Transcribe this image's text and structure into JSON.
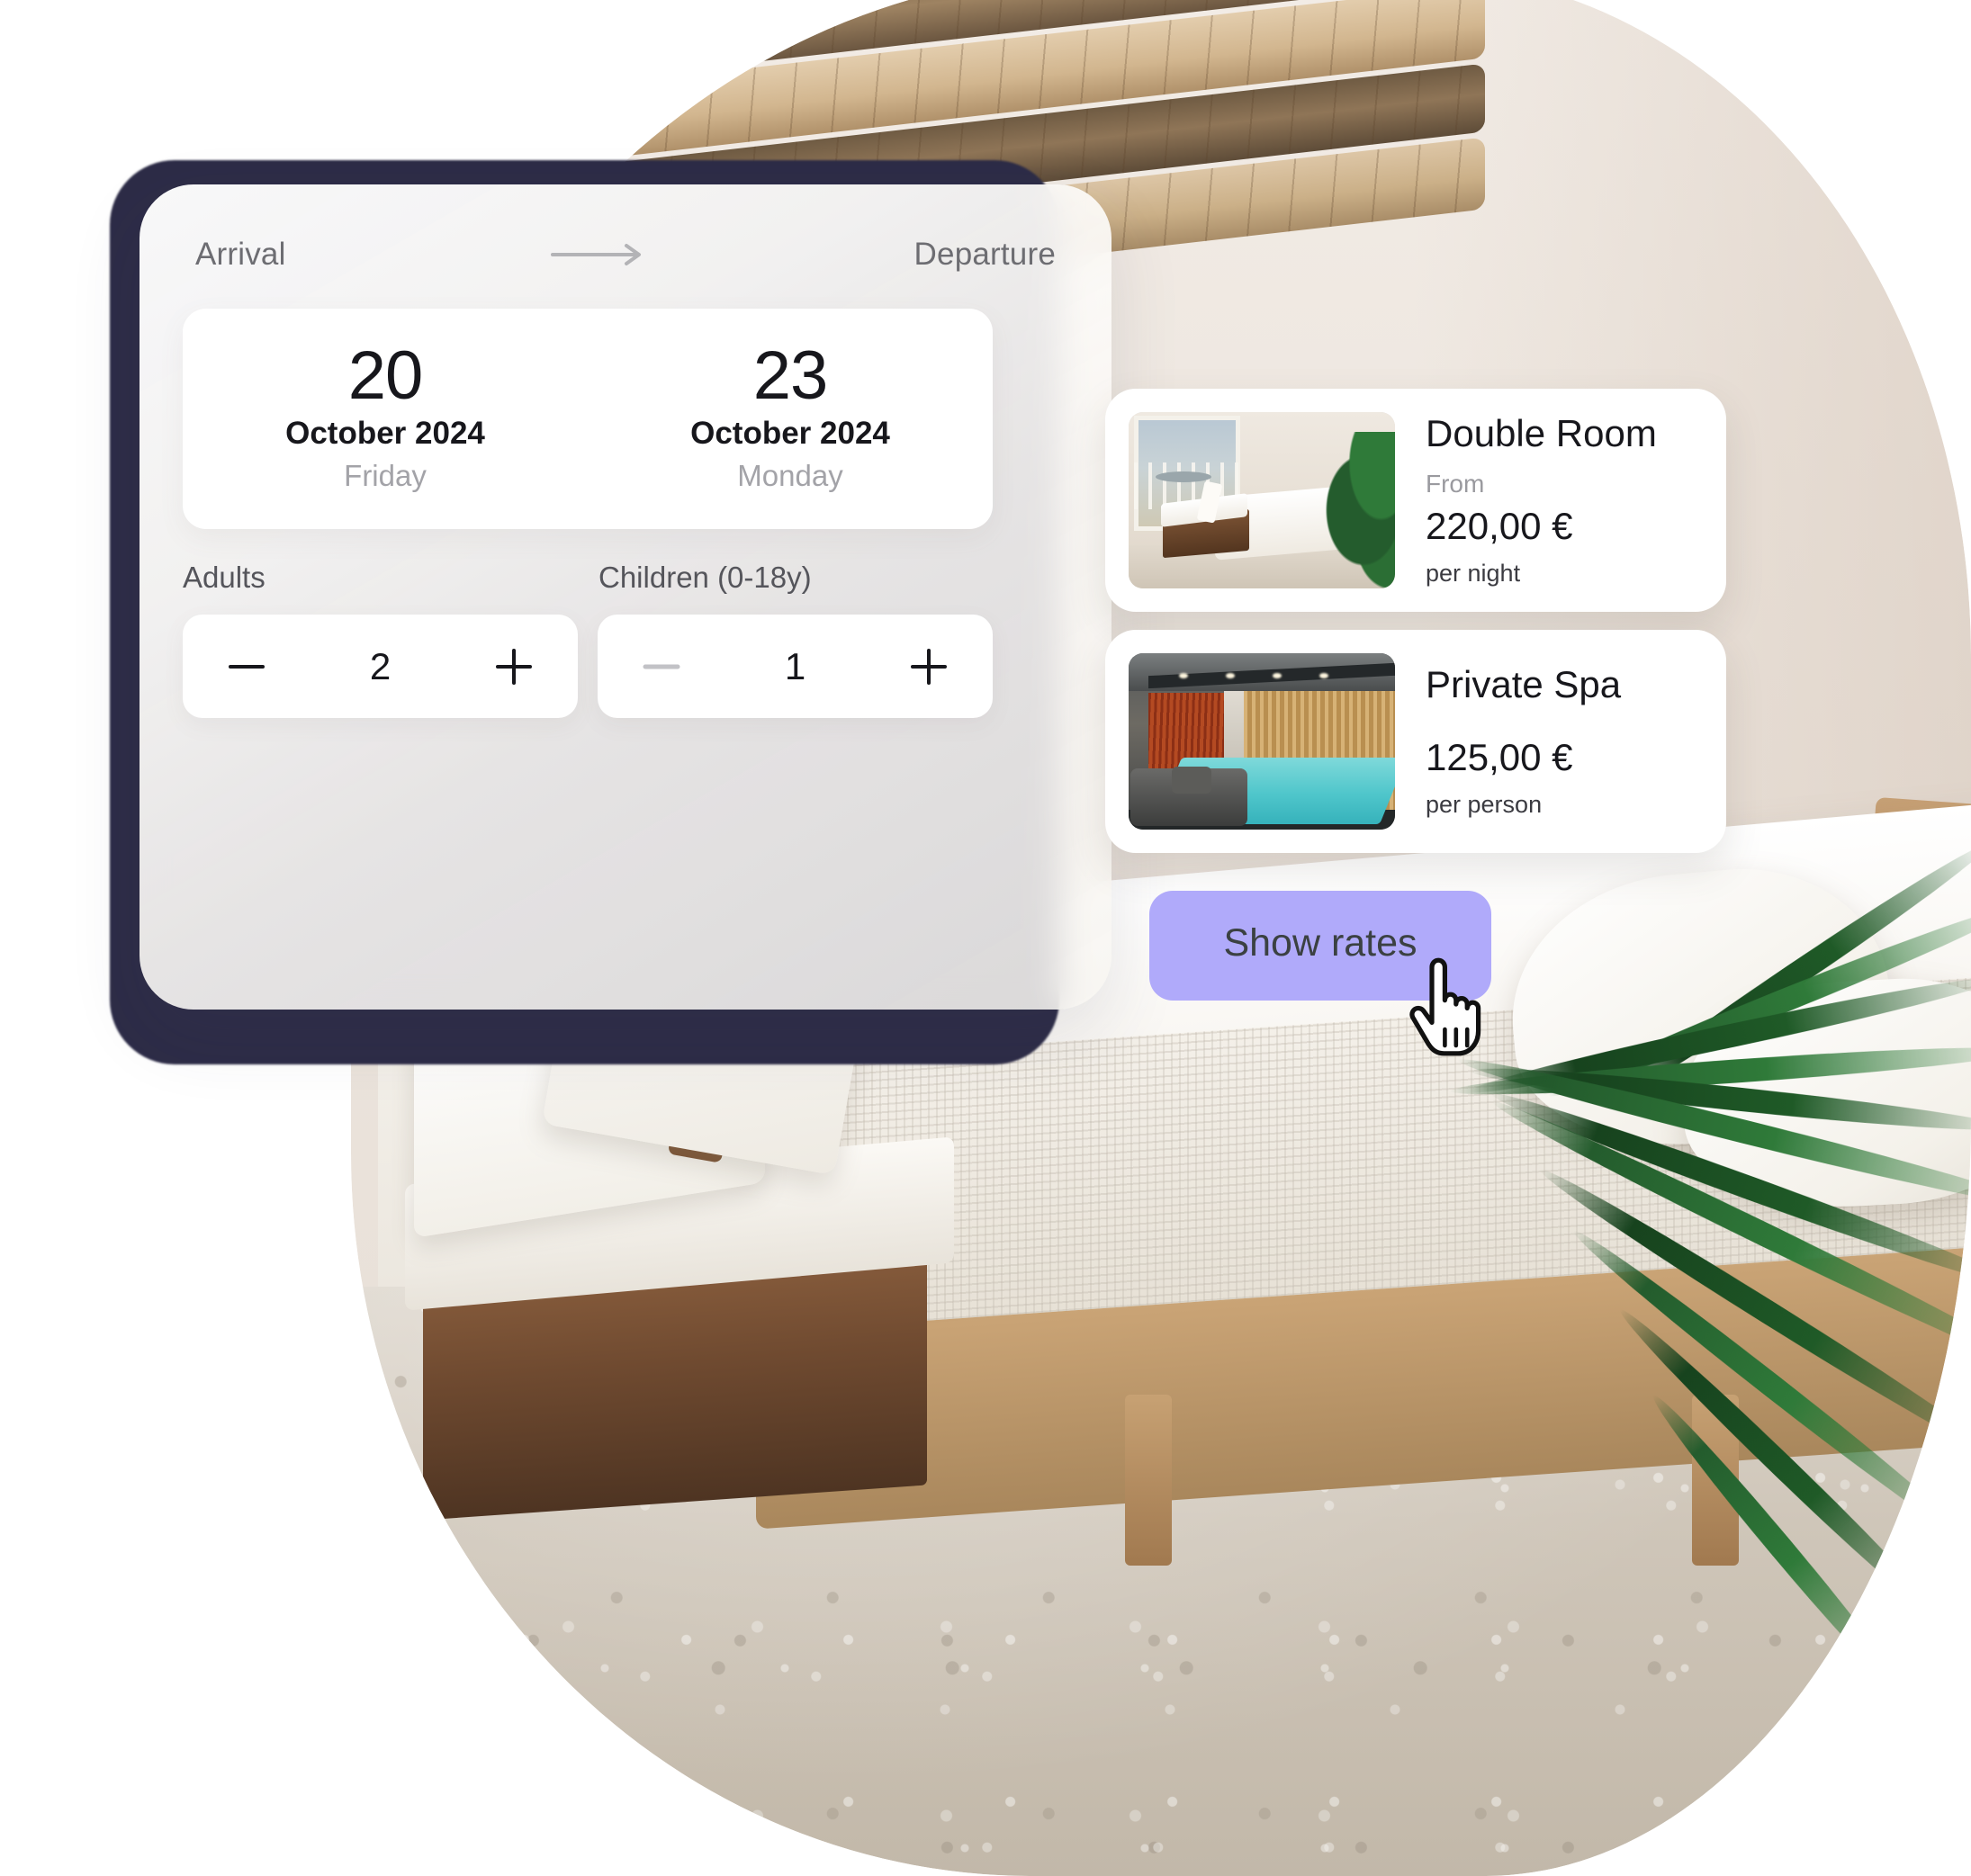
{
  "booking": {
    "arrival_label": "Arrival",
    "departure_label": "Departure",
    "arrow_icon": "arrow-right-icon",
    "arrival": {
      "day": "20",
      "month_year": "October 2024",
      "weekday": "Friday"
    },
    "departure": {
      "day": "23",
      "month_year": "October 2024",
      "weekday": "Monday"
    },
    "adults": {
      "label": "Adults",
      "value": "2",
      "decrement_icon": "minus-icon",
      "increment_icon": "plus-icon",
      "decrement_enabled": true
    },
    "children": {
      "label": "Children (0-18y)",
      "value": "1",
      "decrement_icon": "minus-icon",
      "increment_icon": "plus-icon",
      "decrement_enabled": false
    }
  },
  "offers": [
    {
      "title": "Double Room",
      "from_label": "From",
      "price": "220,00 €",
      "unit": "per night",
      "thumb_alt": "double-room-photo"
    },
    {
      "title": "Private Spa",
      "from_label": "",
      "price": "125,00 €",
      "unit": "per person",
      "thumb_alt": "private-spa-photo"
    }
  ],
  "cta": {
    "label": "Show rates"
  },
  "cursor": {
    "icon": "pointing-hand-cursor"
  },
  "colors": {
    "cta_background": "#b0aafa",
    "cta_text": "#3b4142",
    "card_background": "#ffffff",
    "shadow_layer": "#2d2c47",
    "primary_text": "#17171c",
    "muted_text": "#9a9a9f",
    "label_text": "#6d6d72"
  }
}
